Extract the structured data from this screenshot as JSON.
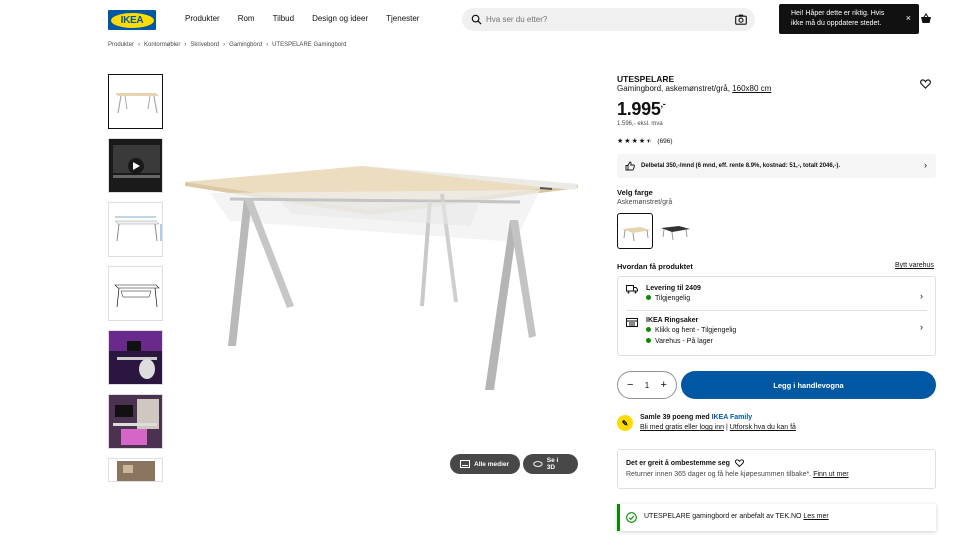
{
  "header": {
    "logo_text": "IKEA",
    "nav": [
      "Produkter",
      "Rom",
      "Tilbud",
      "Design og ideer",
      "Tjenester"
    ],
    "search_placeholder": "Hva ser du etter?",
    "toast": "Hei! Håper dette er riktig. Hvis ikke må du oppdatere stedet.",
    "toast_close": "×"
  },
  "breadcrumb": [
    "Produkter",
    "Kontormøbler",
    "Skrivebord",
    "Gamingbord",
    "UTESPELARE Gamingbord"
  ],
  "breadcrumb_sep": "›",
  "media": {
    "all_media": "Alle medier",
    "view_3d": "Se i 3D"
  },
  "product": {
    "name": "UTESPELARE",
    "description": "Gamingbord, askemønstret/grå,",
    "size": "160x80 cm",
    "price": "1.995",
    "price_suffix": ",-",
    "price_ex_vat": "1.596,- eksl. mva",
    "rating_value": 4.5,
    "rating_count": "(696)"
  },
  "finance": "Delbetal 350,-/mnd (6 mnd, eff. rente 8.9%, kostnad: 51,-, totalt 2046,-).",
  "color": {
    "label": "Velg farge",
    "selected": "Askemønstret/grå"
  },
  "delivery": {
    "title": "Hvordan få produktet",
    "change_store": "Bytt varehus",
    "shipping_title": "Levering til 2409",
    "shipping_status": "Tilgjengelig",
    "store_title": "IKEA Ringsaker",
    "store_click": "Klikk og hent - Tilgjengelig",
    "store_stock": "Varehus - På lager"
  },
  "cart": {
    "quantity": "1",
    "add_label": "Legg i handlevogna"
  },
  "family": {
    "points_prefix": "Samle 39 poeng med ",
    "program": "IKEA Family",
    "join": "Bli med gratis eller logg inn",
    "divider": "|",
    "explore": "Utforsk hva du kan få"
  },
  "returns": {
    "title": "Det er greit å ombestemme seg",
    "text": "Returner innen 365 dager og få hele kjøpesummen tilbake*.",
    "link": "Finn ut mer"
  },
  "recommendation": {
    "text": "UTESPELARE gamingbord er anbefalt av TEK.NO",
    "link": "Les mer"
  },
  "colors": {
    "brand_blue": "#0058a3",
    "brand_yellow": "#ffdb00",
    "available_green": "#0a8a00"
  }
}
